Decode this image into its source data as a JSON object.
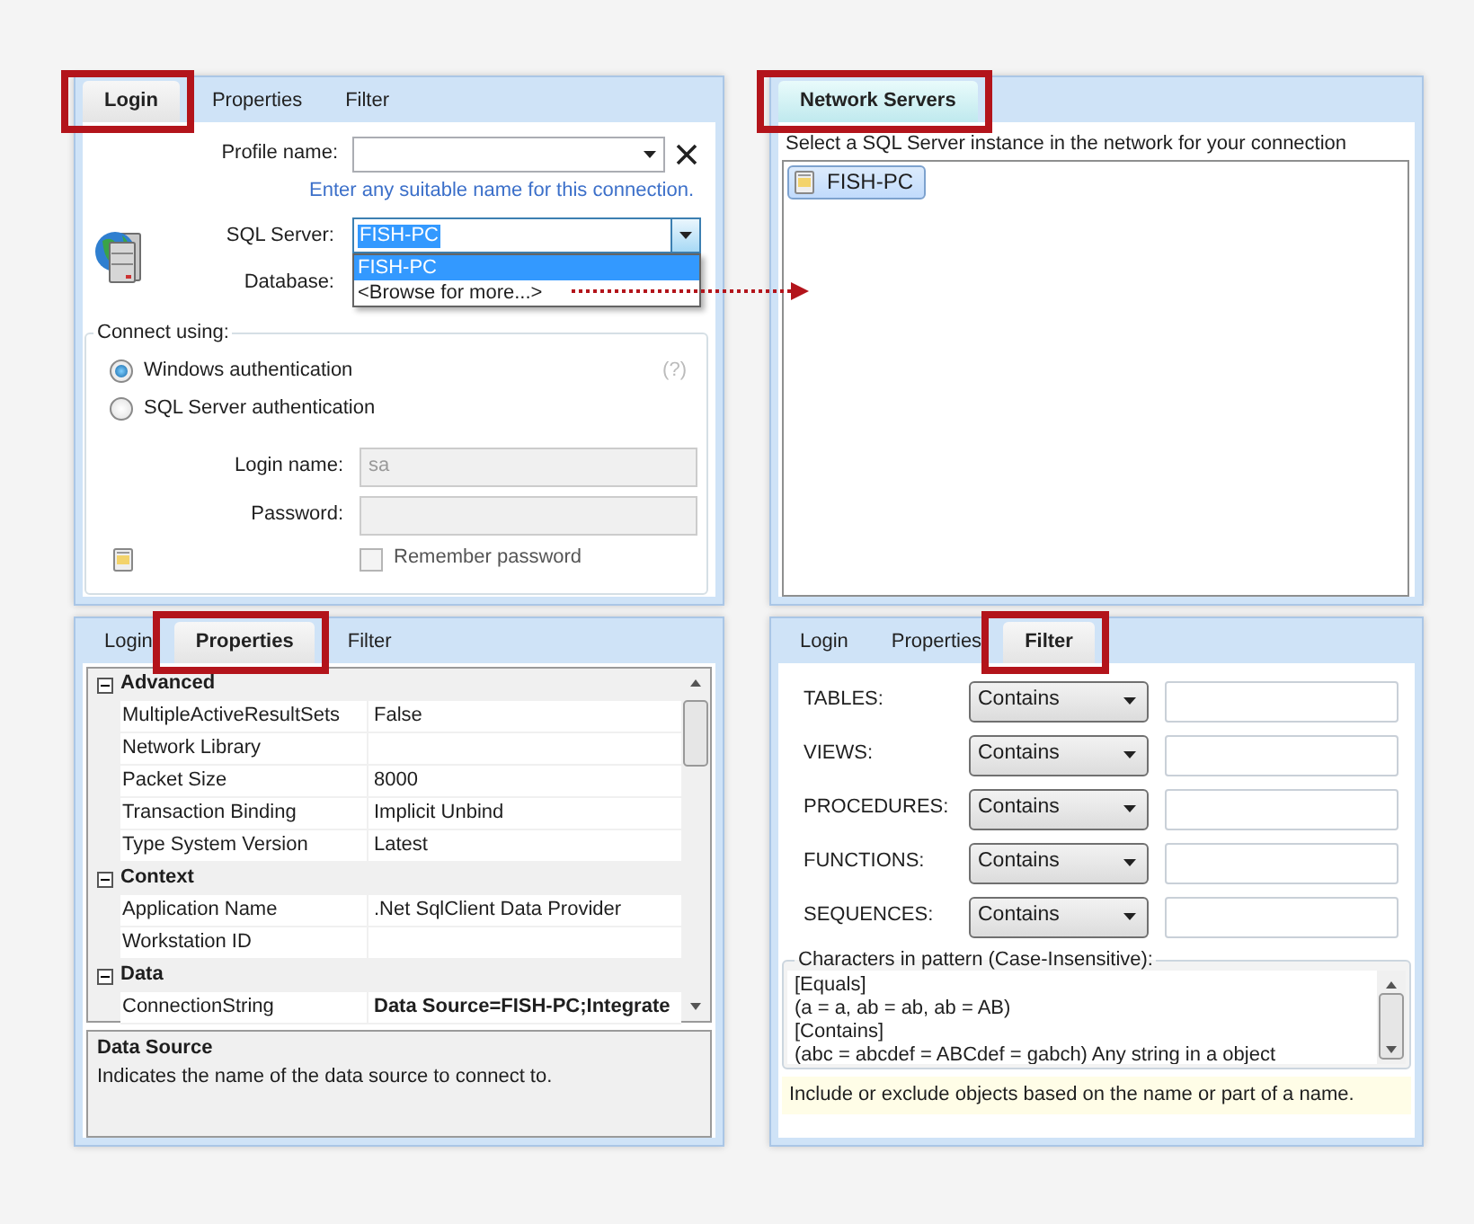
{
  "login_panel": {
    "tabs": [
      {
        "label": "Login",
        "selected": true,
        "highlighted": true
      },
      {
        "label": "Properties",
        "selected": false,
        "highlighted": false
      },
      {
        "label": "Filter",
        "selected": false,
        "highlighted": false
      }
    ],
    "profile_name": {
      "label": "Profile name:"
    },
    "hint": "Enter any suitable name for this connection.",
    "sql_server": {
      "label": "SQL Server:",
      "value": "FISH-PC",
      "options": [
        {
          "label": "FISH-PC",
          "selected": true
        },
        {
          "label": "<Browse for more...>",
          "selected": false
        }
      ]
    },
    "database": {
      "label": "Database:"
    },
    "connect_using": {
      "title": "Connect using:",
      "help": "(?)",
      "options": [
        {
          "label": "Windows authentication",
          "selected": true
        },
        {
          "label": "SQL Server authentication",
          "selected": false
        }
      ]
    },
    "login_name": {
      "label": "Login name:",
      "value": "sa",
      "disabled": true
    },
    "password": {
      "label": "Password:",
      "disabled": true
    },
    "remember_password": {
      "label": "Remember password",
      "checked": false,
      "disabled": true
    }
  },
  "network_panel": {
    "tabs": [
      {
        "label": "Network Servers",
        "selected": true,
        "highlighted": true
      }
    ],
    "instruction": "Select a SQL Server instance in the network for your connection",
    "servers": [
      {
        "label": "FISH-PC",
        "selected": true
      }
    ]
  },
  "properties_panel": {
    "tabs": [
      {
        "label": "Login",
        "selected": false,
        "highlighted": false
      },
      {
        "label": "Properties",
        "selected": true,
        "highlighted": true
      },
      {
        "label": "Filter",
        "selected": false,
        "highlighted": false
      }
    ],
    "groups": [
      {
        "name": "Advanced",
        "expanded": true,
        "rows": [
          {
            "name": "MultipleActiveResultSets",
            "value": "False",
            "modified": false
          },
          {
            "name": "Network Library",
            "modified": false
          },
          {
            "name": "Packet Size",
            "value": "8000",
            "modified": false
          },
          {
            "name": "Transaction Binding",
            "value": "Implicit Unbind",
            "modified": false
          },
          {
            "name": "Type System Version",
            "value": "Latest",
            "modified": false
          }
        ]
      },
      {
        "name": "Context",
        "expanded": true,
        "rows": [
          {
            "name": "Application Name",
            "value": ".Net SqlClient Data Provider",
            "modified": false
          },
          {
            "name": "Workstation ID",
            "modified": false
          }
        ]
      },
      {
        "name": "Data",
        "expanded": true,
        "rows": [
          {
            "name": "ConnectionString",
            "value": "Data Source=FISH-PC;Integrate",
            "modified": true
          }
        ]
      }
    ],
    "description": {
      "title": "Data Source",
      "text": "Indicates the name of the data source to connect to."
    }
  },
  "filter_panel": {
    "tabs": [
      {
        "label": "Login",
        "selected": false,
        "highlighted": false
      },
      {
        "label": "Properties",
        "selected": false,
        "highlighted": false
      },
      {
        "label": "Filter",
        "selected": true,
        "highlighted": true
      }
    ],
    "filters": [
      {
        "label": "TABLES:",
        "mode": "Contains"
      },
      {
        "label": "VIEWS:",
        "mode": "Contains"
      },
      {
        "label": "PROCEDURES:",
        "mode": "Contains"
      },
      {
        "label": "FUNCTIONS:",
        "mode": "Contains"
      },
      {
        "label": "SEQUENCES:",
        "mode": "Contains"
      }
    ],
    "pattern_help": {
      "title": "Characters in pattern (Case-Insensitive):",
      "lines": [
        "[Equals]",
        "(a = a, ab = ab, ab = AB)",
        "[Contains]",
        "(abc = abcdef = ABCdef = gabch) Any string in a object"
      ]
    },
    "hint": "Include or exclude objects based on the name or part of a name."
  }
}
